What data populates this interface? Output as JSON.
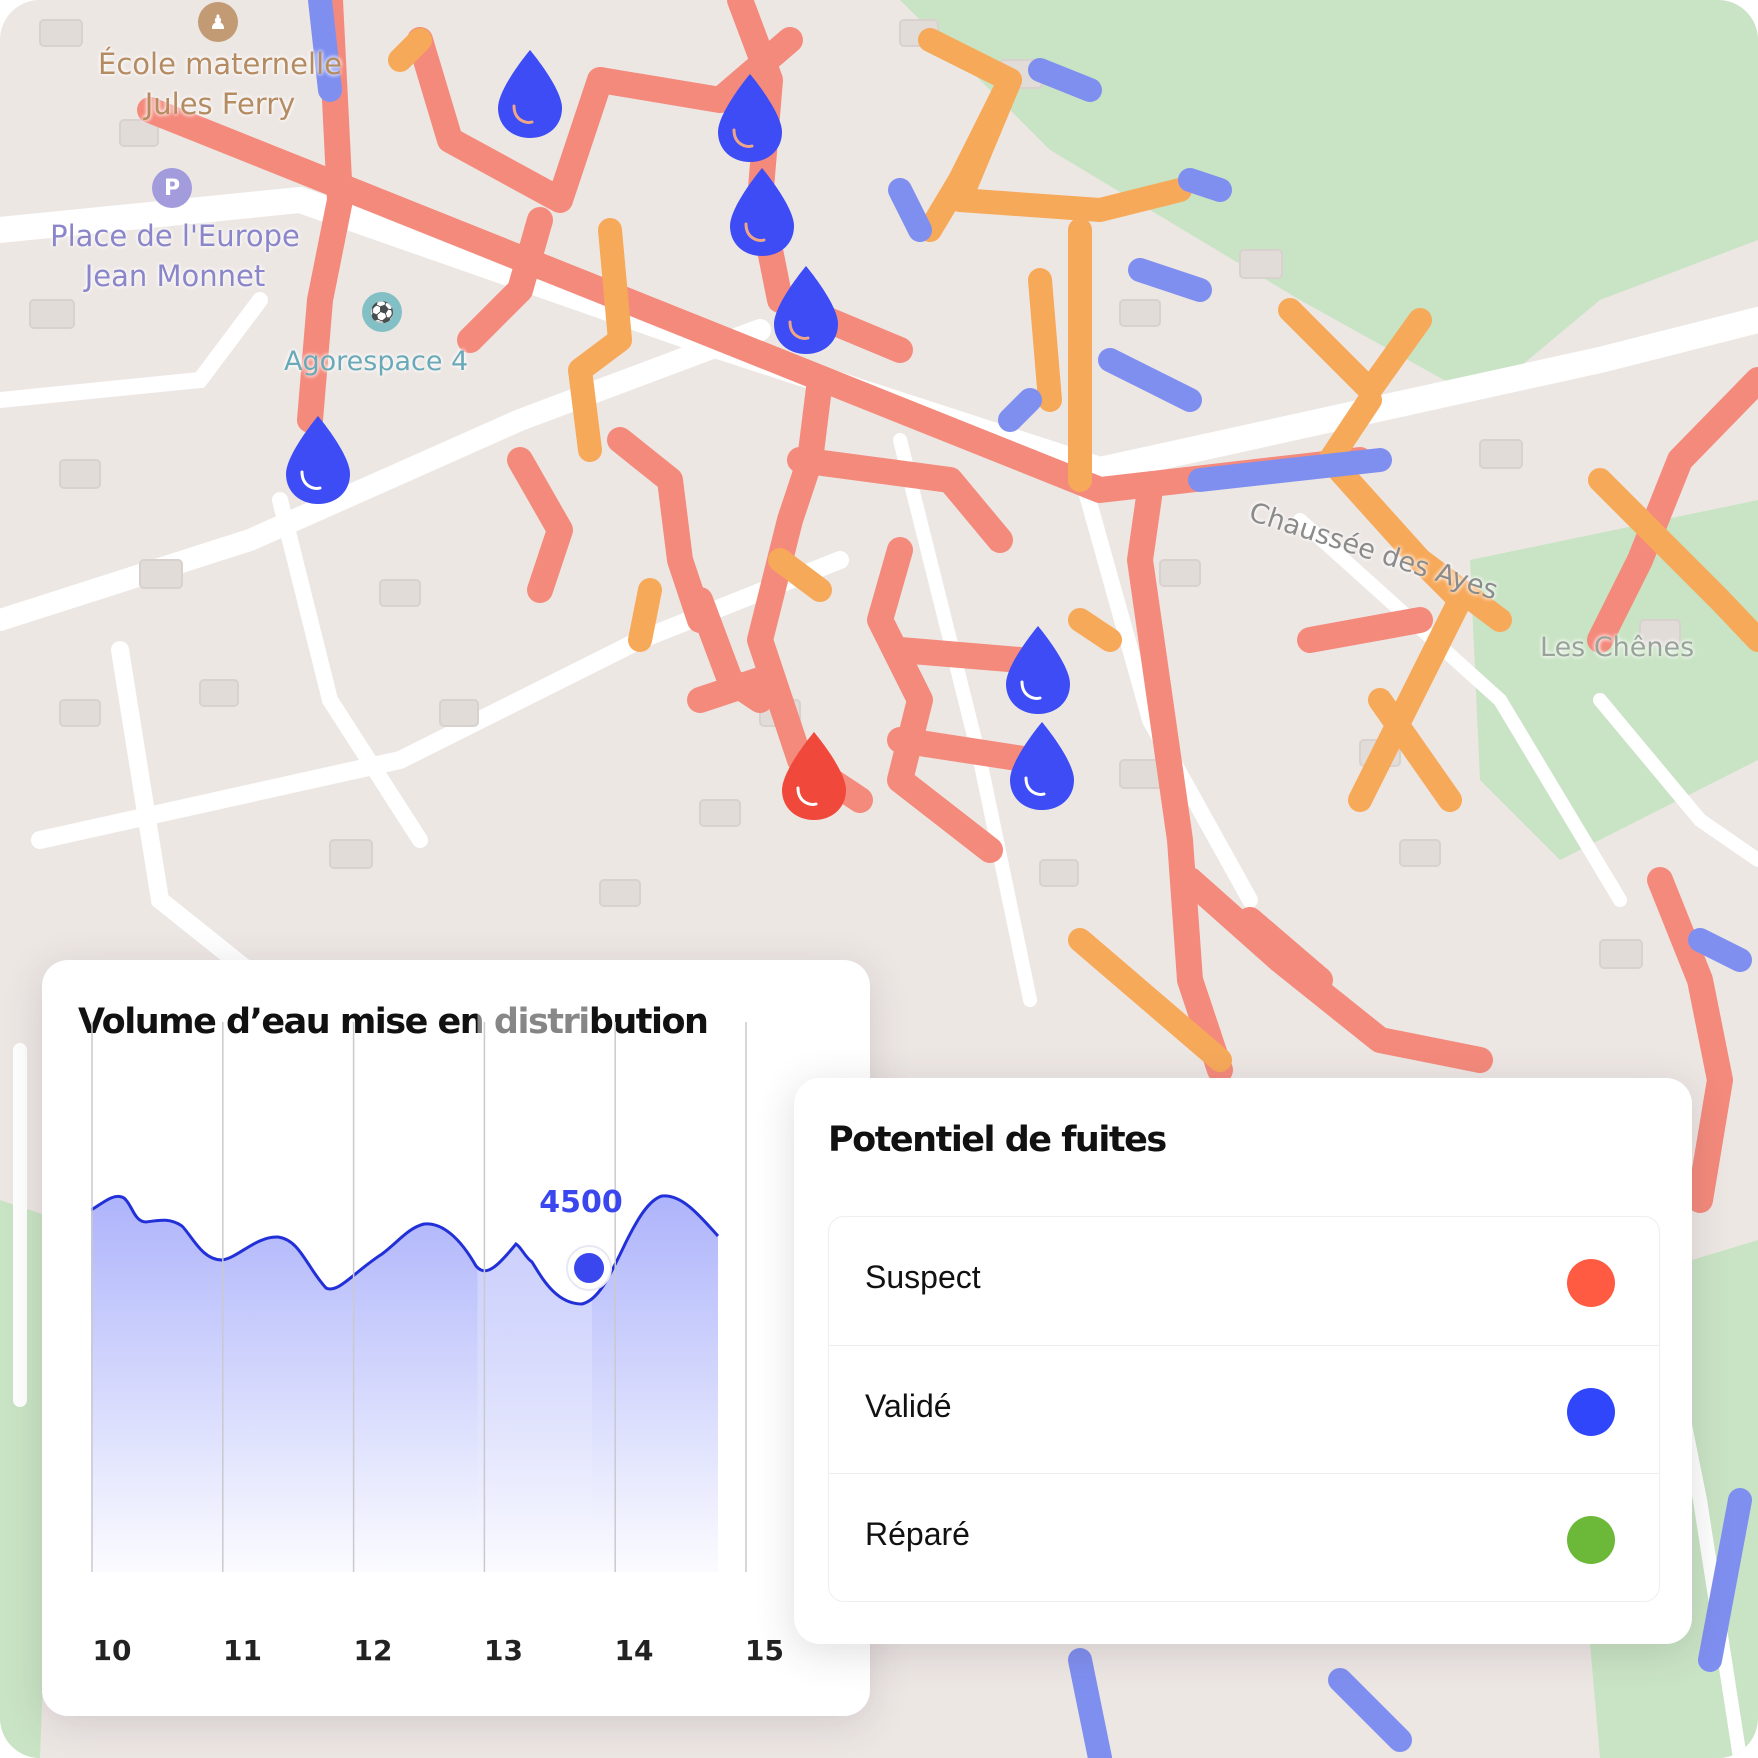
{
  "map": {
    "labels": {
      "school": "École maternelle\nJules Ferry",
      "square": "Place de l'Europe\nJean Monnet",
      "sport": "Agorespace 4",
      "street": "Chaussée des Ayes",
      "area": "Les Chênes"
    },
    "icons": {
      "school_icon": "school-icon",
      "parking_icon": "P",
      "sport_icon": "soccer-icon"
    },
    "colors": {
      "pipe_suspect": "#f48a7c",
      "pipe_orange": "#f7a95a",
      "pipe_blue": "#7f8ff0",
      "green_area": "#c8e3c3",
      "pin_valid": "#3d4cf4",
      "pin_suspect": "#f0483a"
    },
    "pins": [
      "valid",
      "valid",
      "valid",
      "valid",
      "valid",
      "valid",
      "valid",
      "suspect"
    ]
  },
  "chart_card": {
    "title": "Volume d’eau mise en distribution"
  },
  "chart_data": {
    "type": "area",
    "title": "Volume d’eau mise en distribution",
    "xlabel": "",
    "ylabel": "",
    "x_ticks": [
      "10",
      "11",
      "12",
      "13",
      "14",
      "15"
    ],
    "highlight": {
      "x": 13.8,
      "value": 4500,
      "label": "4500"
    },
    "color": "#3d4cf4",
    "grid": "vertical"
  },
  "legend_card": {
    "title": "Potentiel de fuites",
    "items": [
      {
        "label": "Suspect",
        "color": "#ff5a42"
      },
      {
        "label": "Validé",
        "color": "#2f46fb"
      },
      {
        "label": "Réparé",
        "color": "#6cb838"
      }
    ]
  }
}
